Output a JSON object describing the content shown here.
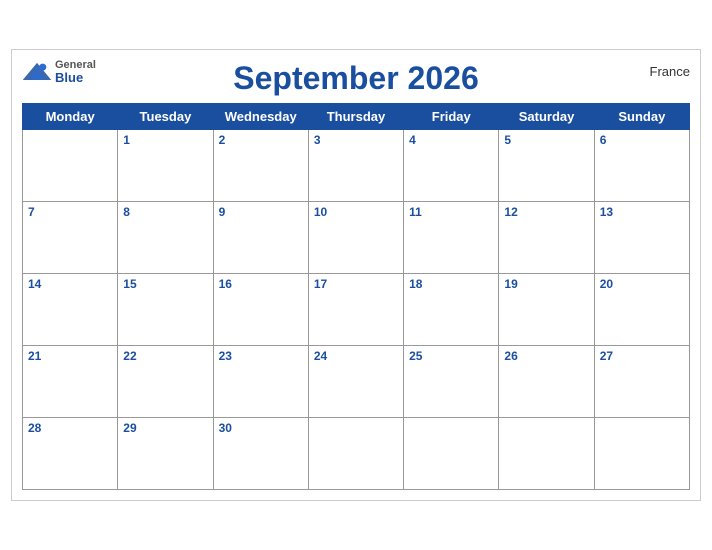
{
  "calendar": {
    "title": "September 2026",
    "country": "France",
    "logo": {
      "general": "General",
      "blue": "Blue"
    },
    "days_of_week": [
      "Monday",
      "Tuesday",
      "Wednesday",
      "Thursday",
      "Friday",
      "Saturday",
      "Sunday"
    ],
    "weeks": [
      [
        null,
        1,
        2,
        3,
        4,
        5,
        6
      ],
      [
        7,
        8,
        9,
        10,
        11,
        12,
        13
      ],
      [
        14,
        15,
        16,
        17,
        18,
        19,
        20
      ],
      [
        21,
        22,
        23,
        24,
        25,
        26,
        27
      ],
      [
        28,
        29,
        30,
        null,
        null,
        null,
        null
      ]
    ]
  }
}
